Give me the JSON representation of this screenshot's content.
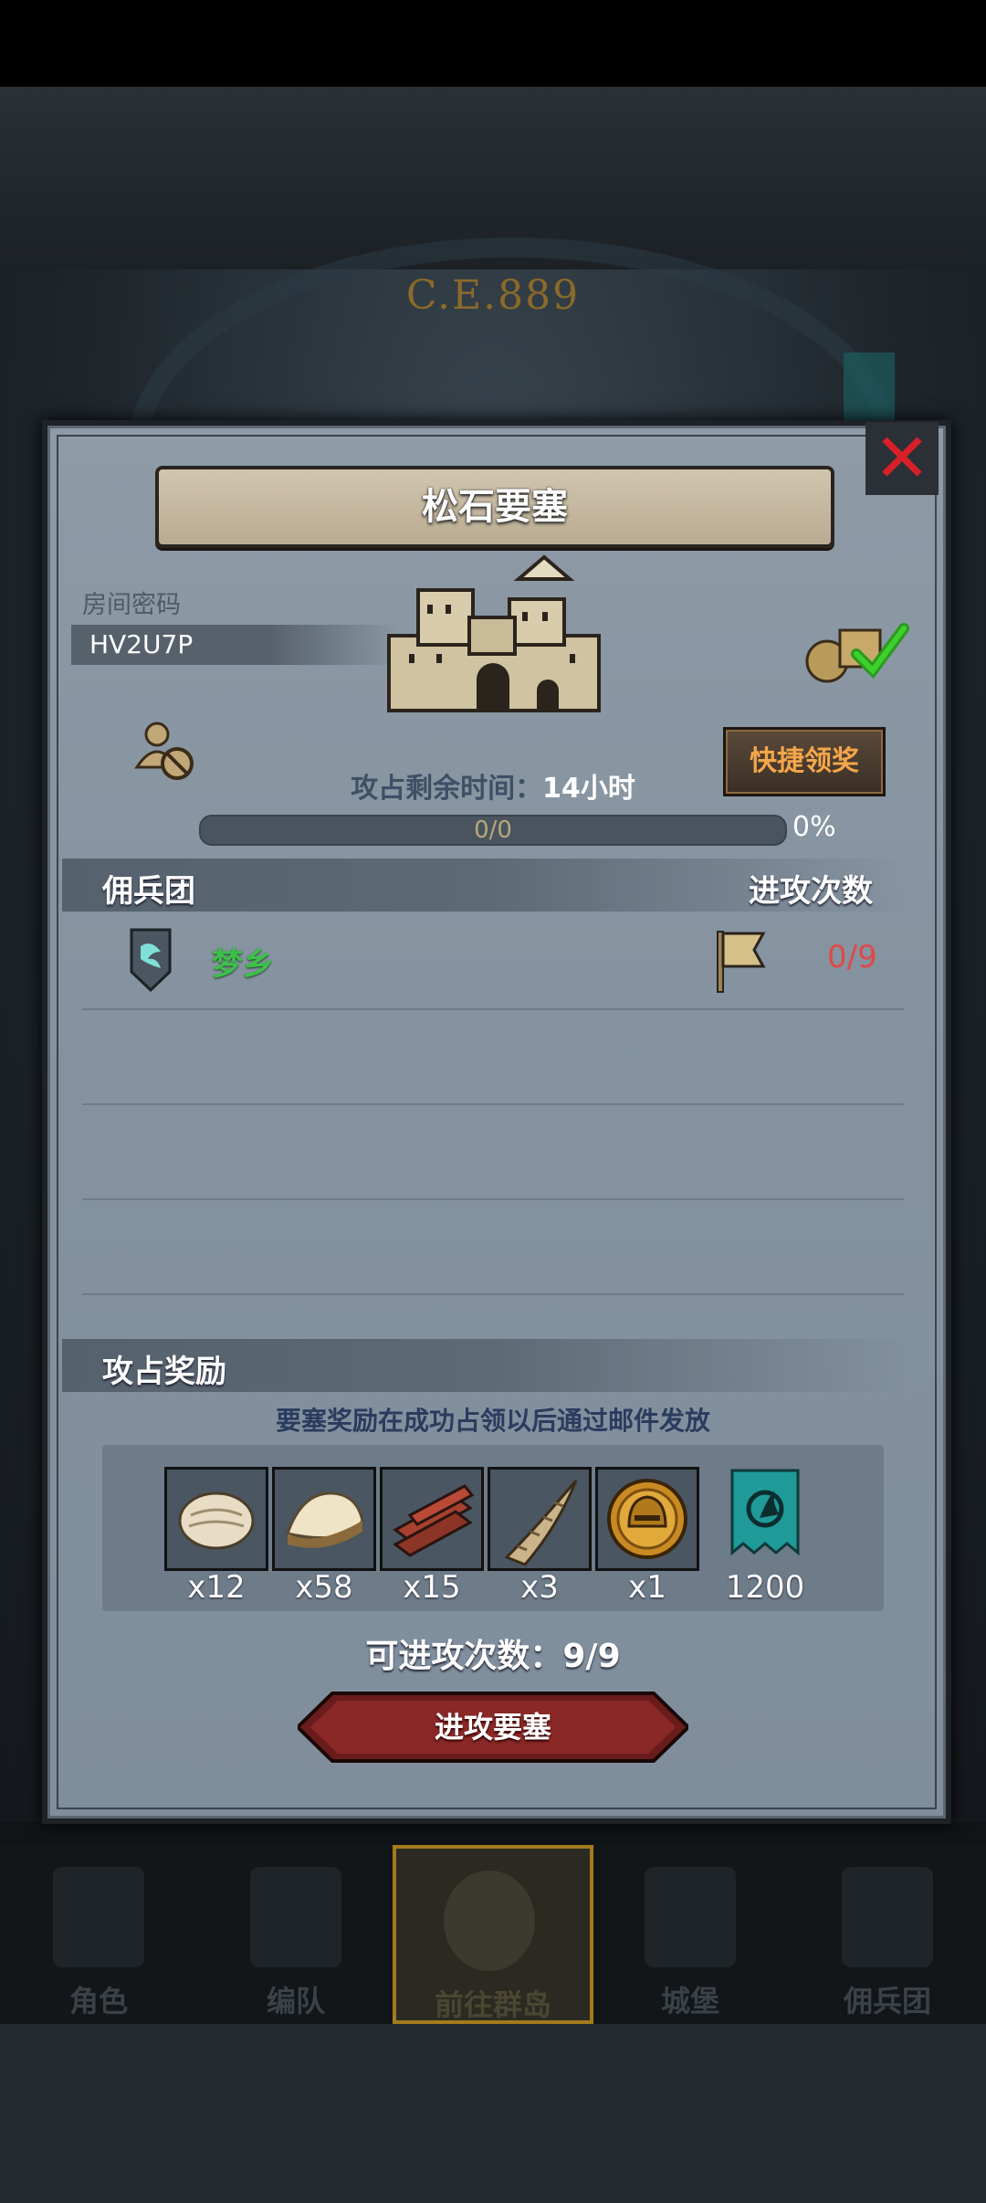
{
  "background": {
    "era_text": "C.E.889"
  },
  "panel": {
    "title": "松石要塞",
    "room_code_label": "房间密码",
    "room_code": "HV2U7P",
    "quick_claim_label": "快捷领奖",
    "time_label_prefix": "攻占剩余时间：",
    "time_value": "14小时",
    "progress_text": "0/0",
    "progress_percent": "0%",
    "progress_fraction": 0,
    "mercenary_header": "佣兵团",
    "attacks_header": "进攻次数",
    "guild": {
      "name": "梦乡",
      "attack_count": "0/9"
    },
    "reward_header": "攻占奖励",
    "reward_note": "要塞奖励在成功占领以后通过邮件发放",
    "rewards": [
      {
        "icon": "fur-icon",
        "qty": "x12"
      },
      {
        "icon": "wool-icon",
        "qty": "x58"
      },
      {
        "icon": "wood-planks-icon",
        "qty": "x15"
      },
      {
        "icon": "horn-icon",
        "qty": "x3"
      },
      {
        "icon": "gold-helmet-coin-icon",
        "qty": "x1"
      },
      {
        "icon": "guild-banner-icon",
        "qty": "1200"
      }
    ],
    "attacks_available": "可进攻次数：9/9",
    "attack_button": "进攻要塞"
  },
  "nav": [
    {
      "label": "角色",
      "icon": "knight-icon"
    },
    {
      "label": "编队",
      "icon": "formation-icon"
    },
    {
      "label": "前往群岛",
      "icon": "islands-compass-icon",
      "active": true
    },
    {
      "label": "城堡",
      "icon": "castle-icon"
    },
    {
      "label": "佣兵团",
      "icon": "mercenary-icon"
    }
  ],
  "colors": {
    "accent_orange": "#f4a64a",
    "guild_green": "#3ec04a",
    "count_red": "#e04848",
    "close_red": "#d8202a"
  }
}
